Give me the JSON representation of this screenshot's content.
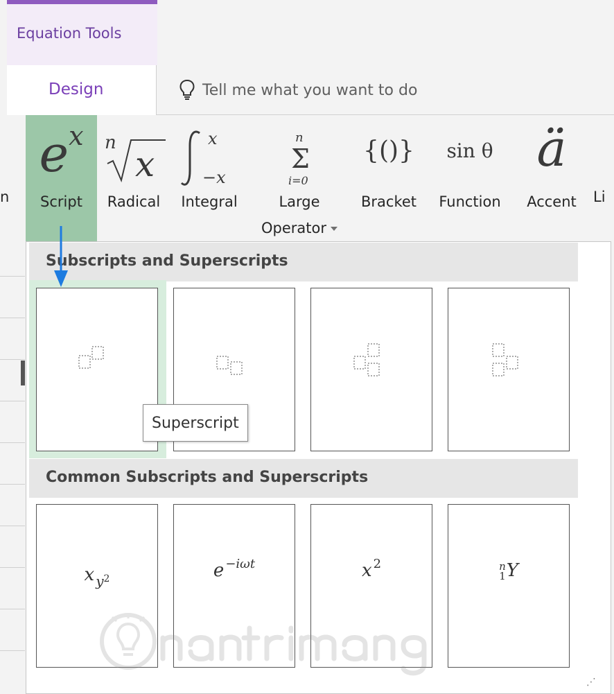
{
  "ribbon_tabs": {
    "context_group": "Equation Tools",
    "active_tab": "Design",
    "tell_me_placeholder": "Tell me what you want to do"
  },
  "ribbon_buttons": {
    "left_cut": "n",
    "script": {
      "symbol": "e",
      "sup": "x",
      "label": "Script"
    },
    "radical": {
      "label": "Radical"
    },
    "integral": {
      "label": "Integral"
    },
    "large_operator": {
      "label_line1": "Large",
      "label_line2": "Operator"
    },
    "bracket": {
      "symbol": "{()}",
      "label": "Bracket"
    },
    "function": {
      "symbol": "sin θ",
      "label": "Function"
    },
    "accent": {
      "symbol": "ä",
      "label": "Accent"
    },
    "right_cut": "Li"
  },
  "dropdown": {
    "section1_title": "Subscripts and Superscripts",
    "section2_title": "Common Subscripts and Superscripts",
    "tooltip": "Superscript",
    "common_items": [
      {
        "base": "x",
        "sub": "y",
        "subsup": "2"
      },
      {
        "base": "e",
        "sup": "−iωt"
      },
      {
        "base": "x",
        "sup": "2"
      },
      {
        "presup": "n",
        "presub": "1",
        "base": "Y"
      }
    ],
    "hovered_item": "Superscript"
  },
  "colors": {
    "accent_purple": "#7a3fb8",
    "script_selected": "#9cc7a8",
    "arrow_blue": "#1e7be0"
  },
  "watermark": "Quantrimang"
}
